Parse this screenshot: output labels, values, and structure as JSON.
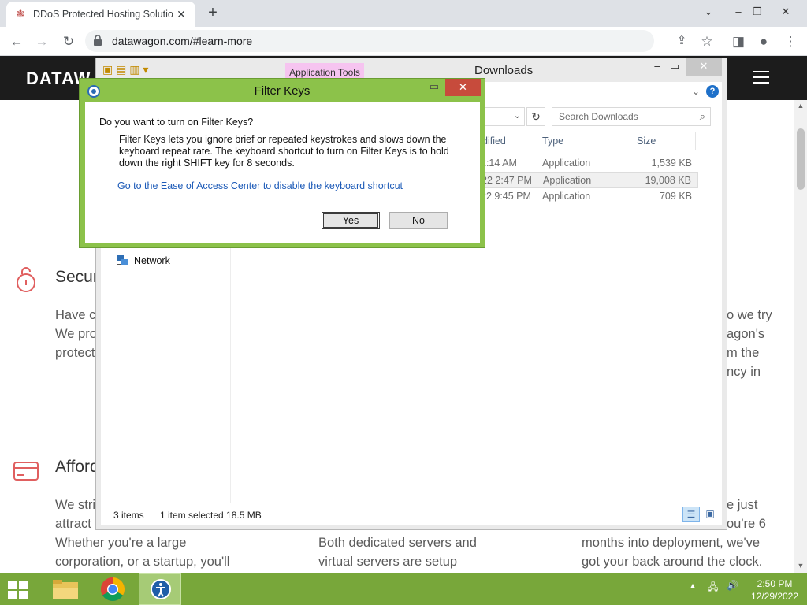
{
  "browser": {
    "tab_title": "DDoS Protected Hosting Solutio",
    "new_tab": "+",
    "url": "datawagon.com/#learn-more"
  },
  "site": {
    "logo": "DATAW",
    "security": {
      "heading": "Secur",
      "line1": "Have c",
      "line2": "We pro",
      "line3": "protect"
    },
    "right_col": {
      "line1": "o we try",
      "line2": "agon's",
      "line3": "m the",
      "line4": "ncy in"
    },
    "afford": {
      "heading": "Afford",
      "line1": "We stri",
      "line2": "attract",
      "line3": "Whether you're a large",
      "line4": "corporation, or a startup, you'll"
    },
    "mid_col": {
      "line1": "Both dedicated servers and",
      "line2": "virtual servers are setup"
    },
    "right_col2": {
      "line1": "e just",
      "line2": "ou're 6",
      "line3": "months into deployment, we've",
      "line4": "got your back around the clock."
    }
  },
  "explorer": {
    "app_tools": "Application Tools",
    "title": "Downloads",
    "search_placeholder": "Search Downloads",
    "columns": {
      "date_partial": "dified",
      "type": "Type",
      "size": "Size"
    },
    "rows": [
      {
        "date": "2:14 AM",
        "type": "Application",
        "size": "1,539 KB"
      },
      {
        "date": "22 2:47 PM",
        "type": "Application",
        "size": "19,008 KB"
      },
      {
        "date": "22 9:45 PM",
        "type": "Application",
        "size": "709 KB"
      }
    ],
    "nav_network": "Network",
    "status_items": "3 items",
    "status_selected": "1 item selected  18.5 MB"
  },
  "dialog": {
    "title": "Filter Keys",
    "question": "Do you want to turn on Filter Keys?",
    "description": "Filter Keys lets you ignore brief or repeated keystrokes and slows down the keyboard repeat rate.  The keyboard shortcut to turn on Filter Keys is to hold down the right SHIFT key for 8 seconds.",
    "link": "Go to the Ease of Access Center to disable the keyboard shortcut",
    "yes": "Yes",
    "no": "No"
  },
  "taskbar": {
    "time": "2:50 PM",
    "date": "12/29/2022"
  },
  "colors": {
    "dialog_frame": "#8cc24a",
    "taskbar": "#78a73a",
    "site_header": "#1c1c1c",
    "accent_icon": "#e05f5f"
  }
}
